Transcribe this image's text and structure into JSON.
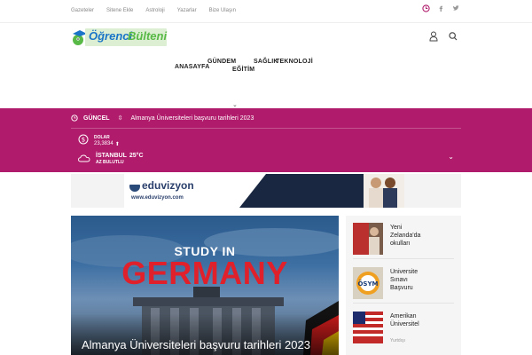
{
  "topbar": {
    "links": [
      "Gazeteler",
      "Sitene Ekle",
      "Astroloji",
      "Yazarlar",
      "Bize Ulaşın"
    ]
  },
  "header": {
    "logo_text": {
      "part1": "Öğrenci",
      "part2": "Bülteni"
    },
    "nav": {
      "anasayfa": "ANASAYFA",
      "gundem": "GÜNDEM",
      "egitim": "EĞİTİM",
      "saglik": "SAĞLIK",
      "teknoloji": "TEKNOLOJİ"
    }
  },
  "ticker": {
    "label": "GÜNCEL",
    "headline": "Almanya Üniversiteleri başvuru tarihleri 2023"
  },
  "currency": {
    "name": "DOLAR",
    "value": "23,3834",
    "trend": "⬆"
  },
  "weather": {
    "city": "İSTANBUL",
    "temp": "25°C",
    "condition": "AZ BULUTLU"
  },
  "ad": {
    "brand": "eduvizyon",
    "url": "www.eduvizyon.com"
  },
  "featured": {
    "overlay_line1": "STUDY IN",
    "overlay_line2": "GERMANY",
    "title": "Almanya Üniversiteleri başvuru tarihleri 2023"
  },
  "sidebar": {
    "items": [
      {
        "title": "Yeni Zelanda'da okulları",
        "author": ""
      },
      {
        "title": "Üniversite Sınavı Başvuru",
        "author": ""
      },
      {
        "title": "Amerikan Üniversitel",
        "author": "Yurtdışı"
      }
    ]
  },
  "colors": {
    "accent": "#b01b6b",
    "logo_blue": "#1a75c8",
    "logo_green": "#58b947",
    "germany_red": "#e0202a"
  }
}
